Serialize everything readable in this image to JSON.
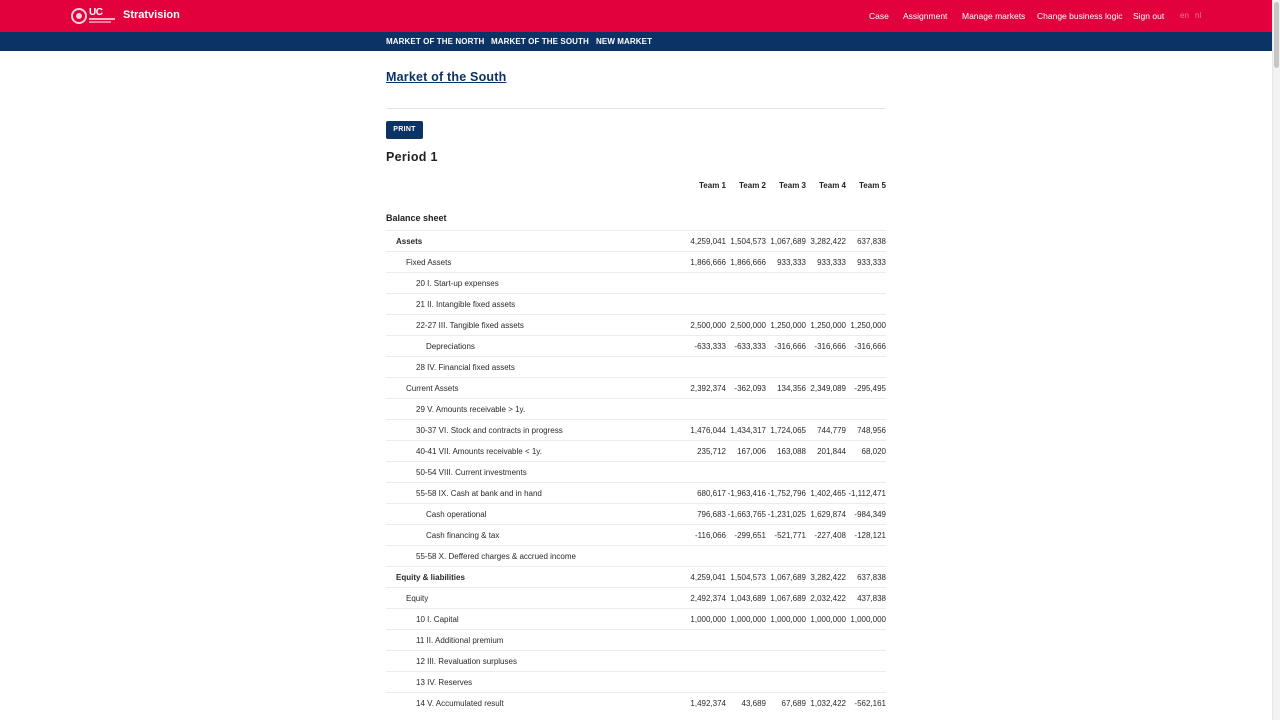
{
  "app": {
    "brand": "Stratvision",
    "logo_text": "UC"
  },
  "topnav": [
    {
      "label": "Case"
    },
    {
      "label": "Assignment"
    },
    {
      "label": "Manage markets"
    },
    {
      "label": "Change business logic"
    },
    {
      "label": "Sign out"
    }
  ],
  "lang": [
    "en",
    "nl"
  ],
  "subnav": [
    {
      "label": "MARKET OF THE NORTH"
    },
    {
      "label": "MARKET OF THE SOUTH"
    },
    {
      "label": "NEW MARKET"
    }
  ],
  "page": {
    "title": "Market of the South",
    "print_label": "PRINT",
    "period": "Period 1",
    "section": "Balance sheet"
  },
  "teams": [
    "Team 1",
    "Team 2",
    "Team 3",
    "Team 4",
    "Team 5"
  ],
  "rows": [
    {
      "label": "Assets",
      "level": 1,
      "bold": true,
      "values": [
        "4,259,041",
        "1,504,573",
        "1,067,689",
        "3,282,422",
        "637,838"
      ]
    },
    {
      "label": "Fixed Assets",
      "level": 2,
      "bold": false,
      "values": [
        "1,866,666",
        "1,866,666",
        "933,333",
        "933,333",
        "933,333"
      ]
    },
    {
      "label": "20 I. Start-up expenses",
      "level": 3,
      "bold": false,
      "values": [
        "",
        "",
        "",
        "",
        ""
      ]
    },
    {
      "label": "21 II. Intangible fixed assets",
      "level": 3,
      "bold": false,
      "values": [
        "",
        "",
        "",
        "",
        ""
      ]
    },
    {
      "label": "22-27 III. Tangible fixed assets",
      "level": 3,
      "bold": false,
      "values": [
        "2,500,000",
        "2,500,000",
        "1,250,000",
        "1,250,000",
        "1,250,000"
      ]
    },
    {
      "label": "Depreciations",
      "level": 4,
      "bold": false,
      "values": [
        "-633,333",
        "-633,333",
        "-316,666",
        "-316,666",
        "-316,666"
      ]
    },
    {
      "label": "28 IV. Financial fixed assets",
      "level": 3,
      "bold": false,
      "values": [
        "",
        "",
        "",
        "",
        ""
      ]
    },
    {
      "label": "Current Assets",
      "level": 2,
      "bold": false,
      "values": [
        "2,392,374",
        "-362,093",
        "134,356",
        "2,349,089",
        "-295,495"
      ]
    },
    {
      "label": "29 V. Amounts receivable > 1y.",
      "level": 3,
      "bold": false,
      "values": [
        "",
        "",
        "",
        "",
        ""
      ]
    },
    {
      "label": "30-37 VI. Stock and contracts in progress",
      "level": 3,
      "bold": false,
      "values": [
        "1,476,044",
        "1,434,317",
        "1,724,065",
        "744,779",
        "748,956"
      ]
    },
    {
      "label": "40-41 VII. Amounts receivable < 1y.",
      "level": 3,
      "bold": false,
      "values": [
        "235,712",
        "167,006",
        "163,088",
        "201,844",
        "68,020"
      ]
    },
    {
      "label": "50-54 VIII. Current investments",
      "level": 3,
      "bold": false,
      "values": [
        "",
        "",
        "",
        "",
        ""
      ]
    },
    {
      "label": "55-58 IX. Cash at bank and in hand",
      "level": 3,
      "bold": false,
      "values": [
        "680,617",
        "-1,963,416",
        "-1,752,796",
        "1,402,465",
        "-1,112,471"
      ]
    },
    {
      "label": "Cash operational",
      "level": 4,
      "bold": false,
      "values": [
        "796,683",
        "-1,663,765",
        "-1,231,025",
        "1,629,874",
        "-984,349"
      ]
    },
    {
      "label": "Cash financing & tax",
      "level": 4,
      "bold": false,
      "values": [
        "-116,066",
        "-299,651",
        "-521,771",
        "-227,408",
        "-128,121"
      ]
    },
    {
      "label": "55-58 X. Deffered charges & accrued income",
      "level": 3,
      "bold": false,
      "values": [
        "",
        "",
        "",
        "",
        ""
      ]
    },
    {
      "label": "Equity & liabilities",
      "level": 1,
      "bold": true,
      "values": [
        "4,259,041",
        "1,504,573",
        "1,067,689",
        "3,282,422",
        "637,838"
      ]
    },
    {
      "label": "Equity",
      "level": 2,
      "bold": false,
      "values": [
        "2,492,374",
        "1,043,689",
        "1,067,689",
        "2,032,422",
        "437,838"
      ]
    },
    {
      "label": "10 I. Capital",
      "level": 3,
      "bold": false,
      "values": [
        "1,000,000",
        "1,000,000",
        "1,000,000",
        "1,000,000",
        "1,000,000"
      ]
    },
    {
      "label": "11 II. Additional premium",
      "level": 3,
      "bold": false,
      "values": [
        "",
        "",
        "",
        "",
        ""
      ]
    },
    {
      "label": "12 III. Revaluation surpluses",
      "level": 3,
      "bold": false,
      "values": [
        "",
        "",
        "",
        "",
        ""
      ]
    },
    {
      "label": "13 IV. Reserves",
      "level": 3,
      "bold": false,
      "values": [
        "",
        "",
        "",
        "",
        ""
      ]
    },
    {
      "label": "14 V. Accumulated result",
      "level": 3,
      "bold": false,
      "values": [
        "1,492,374",
        "43,689",
        "67,689",
        "1,032,422",
        "-562,161"
      ]
    }
  ]
}
